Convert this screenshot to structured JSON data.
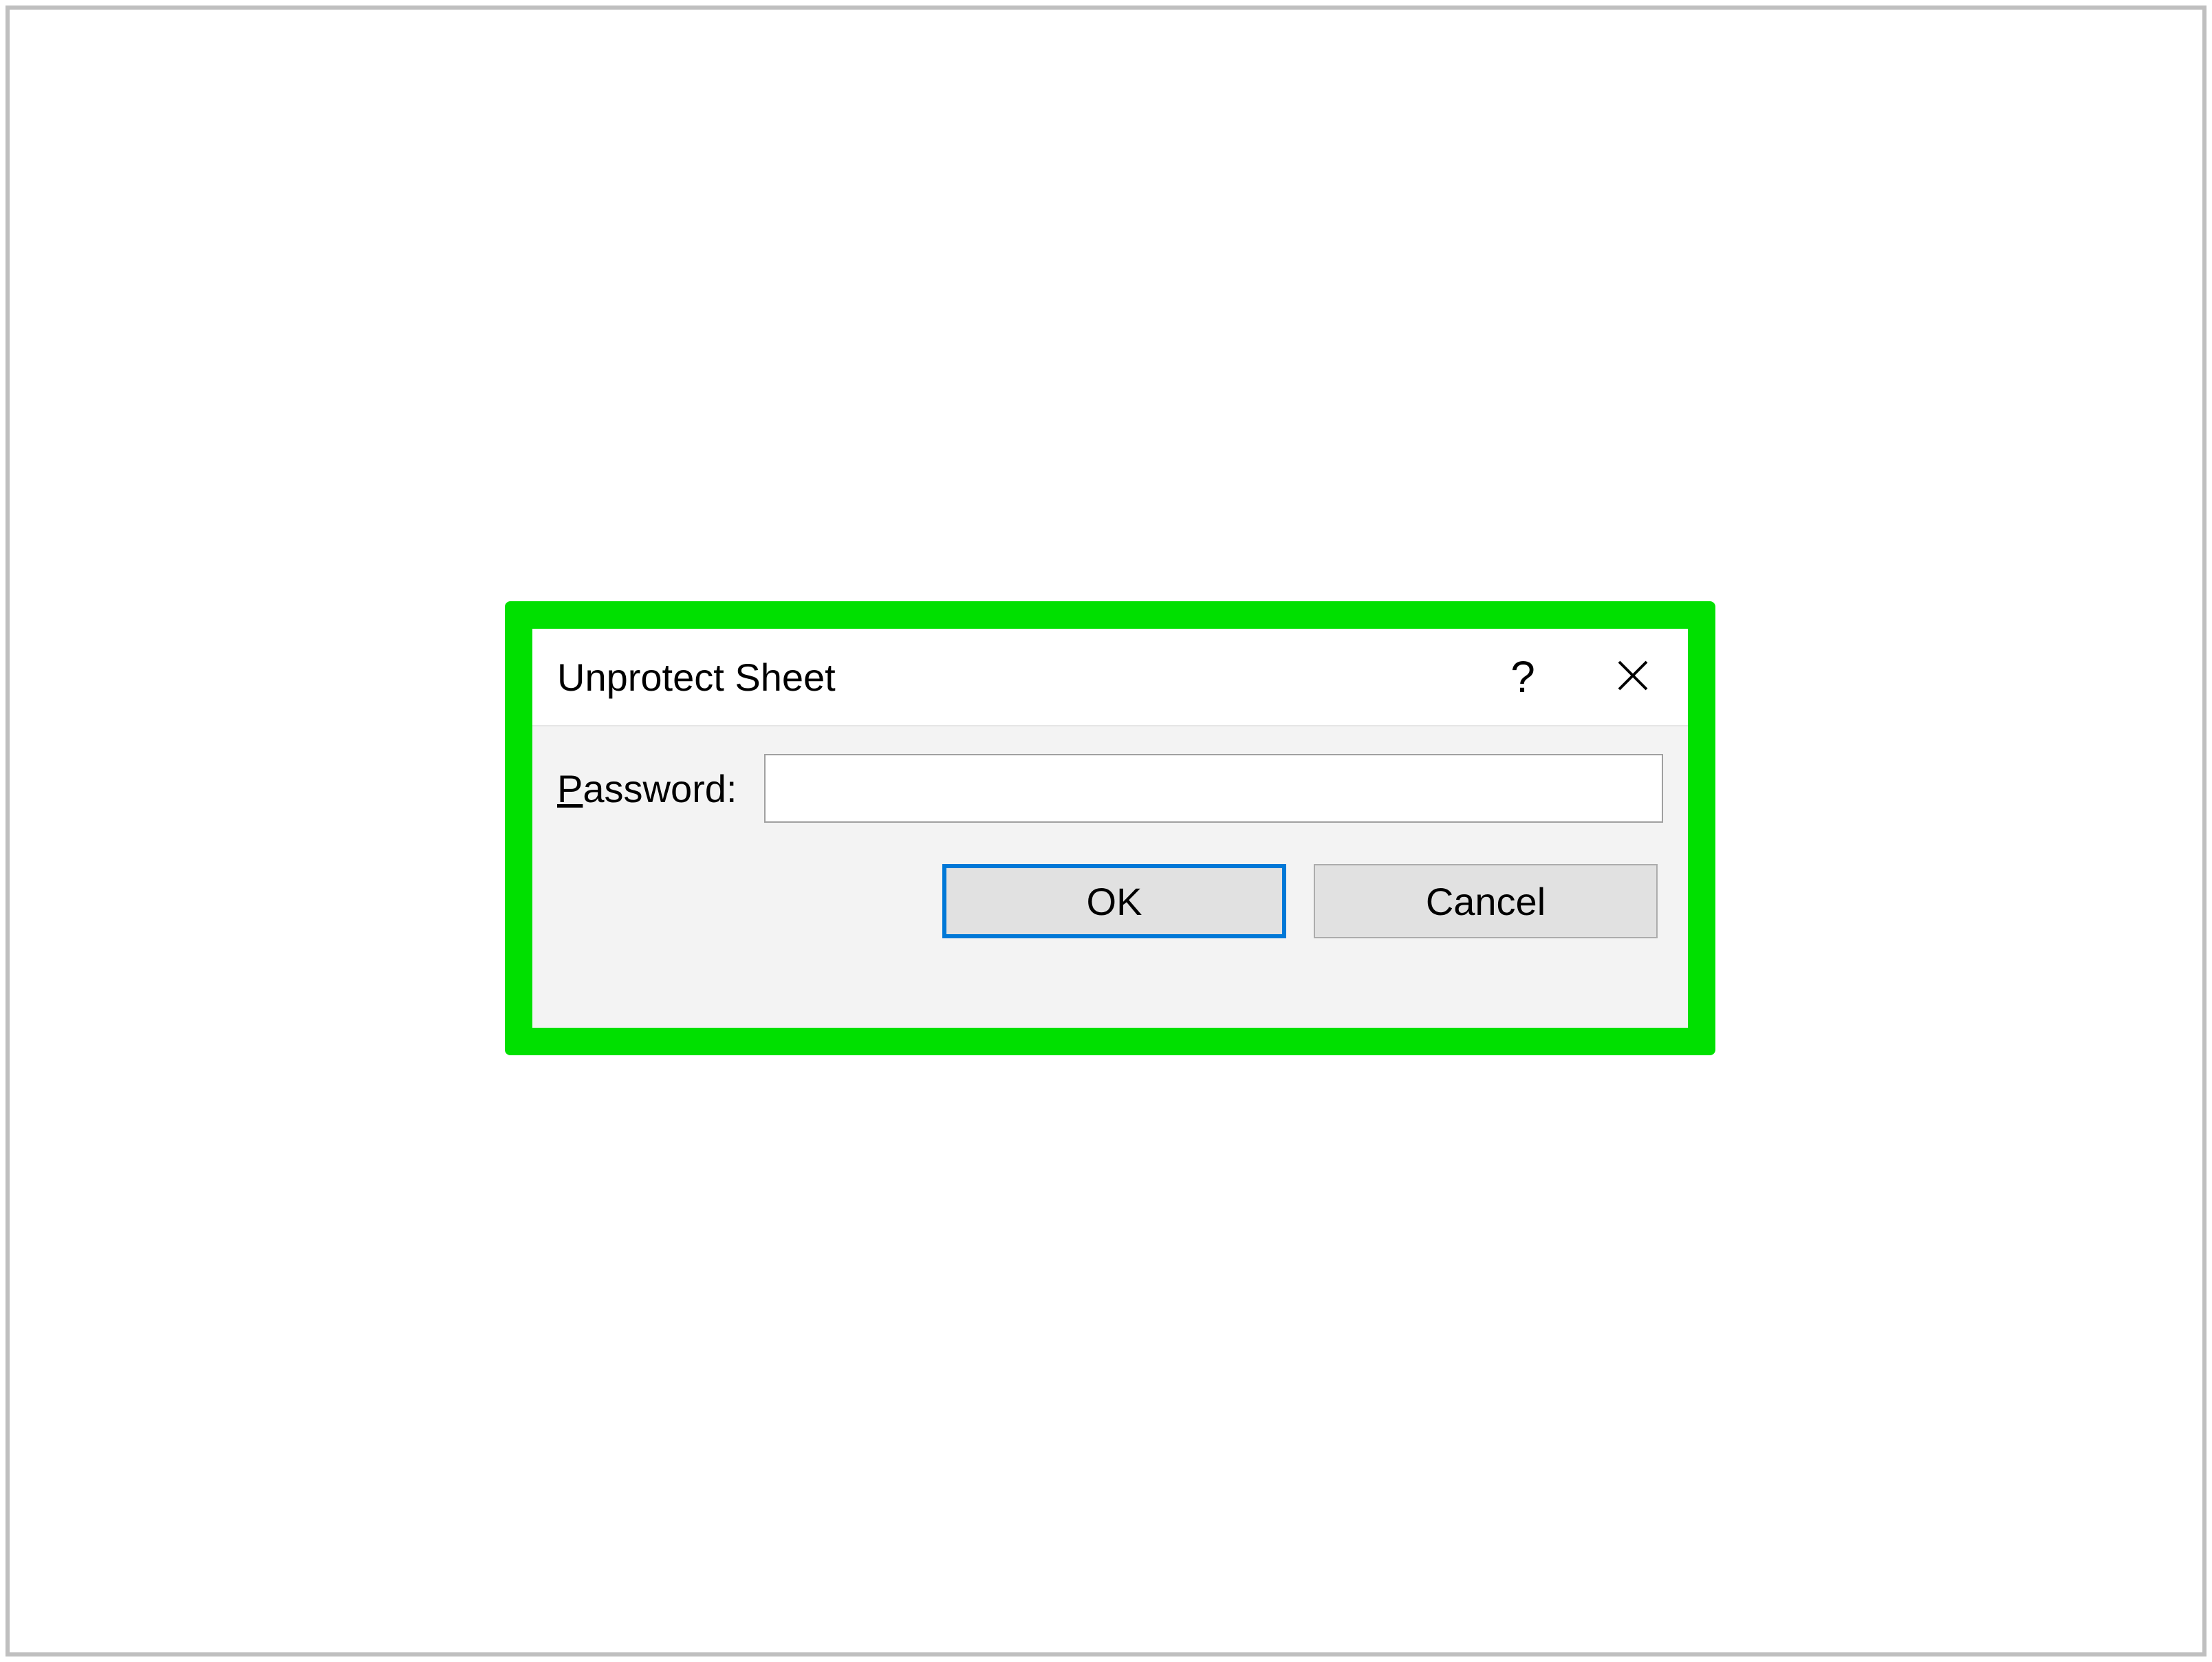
{
  "dialog": {
    "title": "Unprotect Sheet",
    "password_label_prefix": "P",
    "password_label_suffix": "assword:",
    "password_value": "",
    "ok_label": "OK",
    "cancel_label": "Cancel",
    "help_symbol": "?"
  },
  "colors": {
    "highlight": "#00e000",
    "primary_border": "#0078d7",
    "button_bg": "#e1e1e1",
    "body_bg": "#f3f3f3"
  }
}
